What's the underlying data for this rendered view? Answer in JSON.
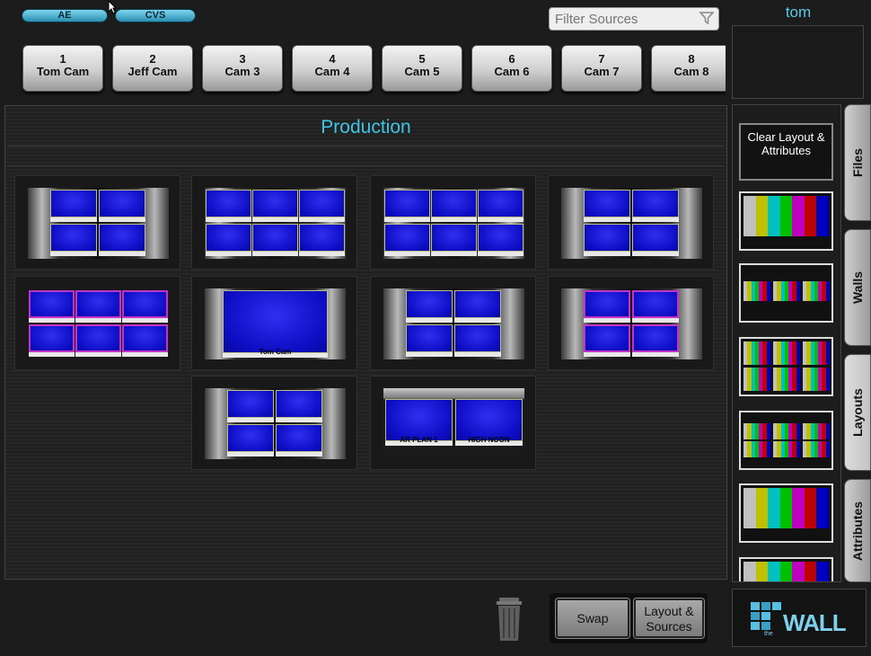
{
  "header": {
    "pills": [
      "AE",
      "CVS"
    ],
    "filter_placeholder": "Filter Sources",
    "user": "tom"
  },
  "sources": [
    {
      "num": "1",
      "name": "Tom Cam"
    },
    {
      "num": "2",
      "name": "Jeff Cam"
    },
    {
      "num": "3",
      "name": "Cam 3"
    },
    {
      "num": "4",
      "name": "Cam 4"
    },
    {
      "num": "5",
      "name": "Cam 5"
    },
    {
      "num": "6",
      "name": "Cam 6"
    },
    {
      "num": "7",
      "name": "Cam 7"
    },
    {
      "num": "8",
      "name": "Cam 8"
    }
  ],
  "workspace": {
    "title": "Production"
  },
  "layout_labels": {
    "single": "Tom Cam",
    "pair_left": "AR PLAN 1",
    "pair_right": "HIGH NOON"
  },
  "sidebar": {
    "clear_label": "Clear Layout & Attributes"
  },
  "tabs": [
    "Files",
    "Walls",
    "Layouts",
    "Attributes"
  ],
  "active_tab": "Layouts",
  "actions": {
    "swap": "Swap",
    "layout_sources": "Layout & Sources"
  },
  "logo": {
    "text": "WALL",
    "small": "the"
  },
  "colors": {
    "accent": "#3fc4e6",
    "monitor": "#1414d8",
    "highlight": "#c234c8"
  }
}
